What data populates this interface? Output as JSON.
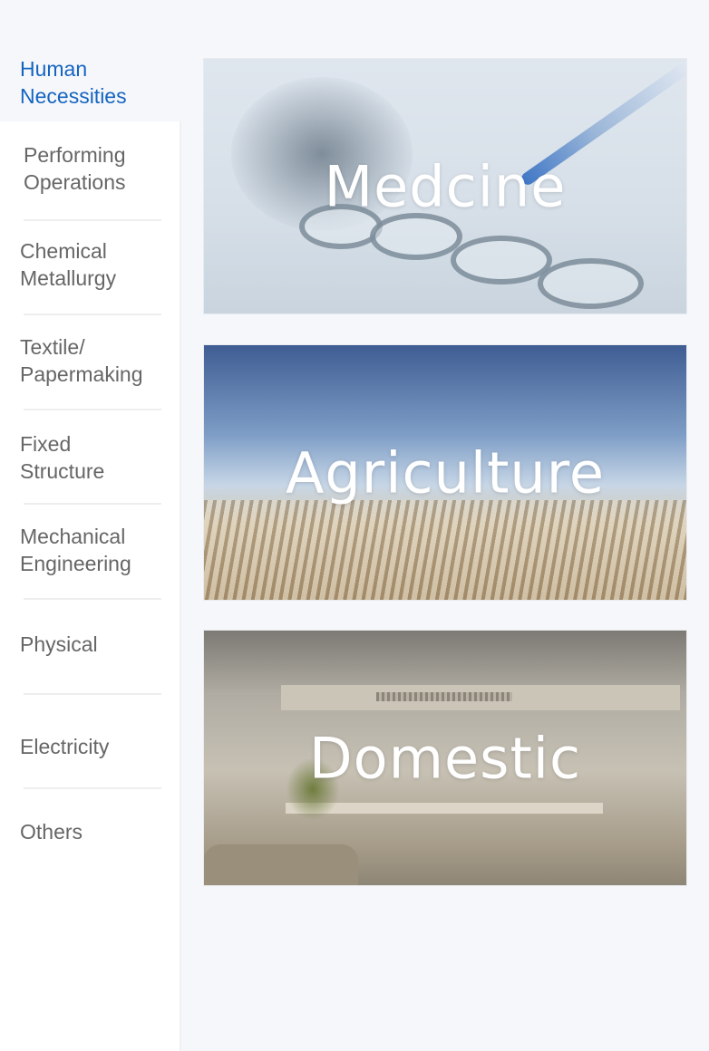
{
  "sidebar": {
    "active_label": "Human Necessities",
    "items": [
      {
        "label": "Performing Operations"
      },
      {
        "label": "Chemical Metallurgy"
      },
      {
        "label": "Textile/ Papermaking"
      },
      {
        "label": "Fixed Structure"
      },
      {
        "label": "Mechanical Engineering"
      },
      {
        "label": "Physical"
      },
      {
        "label": "Electricity"
      },
      {
        "label": "Others"
      }
    ]
  },
  "cards": [
    {
      "label": "Medcine",
      "image": "lab-test-tubes"
    },
    {
      "label": "Agriculture",
      "image": "wheat-field"
    },
    {
      "label": "Domestic",
      "image": "living-room"
    }
  ],
  "colors": {
    "accent": "#1565c0",
    "text": "#666666",
    "background": "#f6f7fb"
  }
}
